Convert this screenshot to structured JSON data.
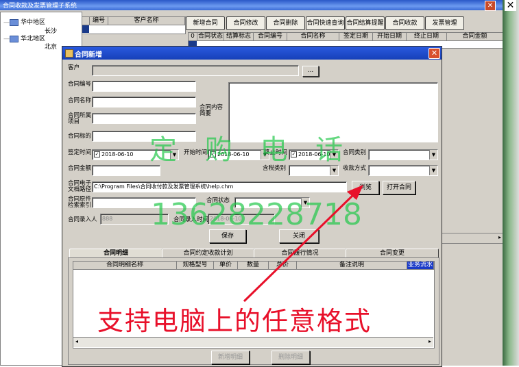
{
  "main": {
    "title": "合同收款及发票管理子系统",
    "close": "✕",
    "right_close": "✕",
    "tree": [
      {
        "label": "华中地区",
        "child": "长沙"
      },
      {
        "label": "华北地区",
        "child": "北京"
      }
    ],
    "grid1_headers": [
      "编号",
      "客户名称"
    ],
    "toolbar": [
      "新增合同",
      "合同修改",
      "合同删除",
      "合同快速查询",
      "合同结算提醒",
      "合同收款",
      "发票管理"
    ],
    "grid2_headers": [
      "0",
      "合同状态",
      "结算标志",
      "合同编号",
      "合同名称",
      "签定日期",
      "开始日期",
      "终止日期",
      "合同金额"
    ]
  },
  "dialog": {
    "title": "合同新增",
    "close": "✕",
    "customer_label": "客户",
    "customer_browse": "...",
    "contract_no_label": "合同编号",
    "contract_name_label": "合同名称",
    "contract_project_label": "合同所属项目",
    "contract_target_label": "合同标的",
    "contract_content_label": "合同内容简要",
    "sign_time_label": "签定时间",
    "sign_time_value": "2018-06-10",
    "start_time_label": "开始时间",
    "start_time_value": "2018-06-10",
    "end_time_label": "终止时间",
    "end_time_value": "2018-06-10",
    "contract_type_label": "合同类别",
    "amount_label": "合同金额",
    "tax_type_label": "含税类别",
    "payment_method_label": "收款方式",
    "doc_path_label": "合同电子文档路径",
    "doc_path_value": "C:\\Program Files\\合同收付款及发票管理系统\\help.chm",
    "browse_button": "浏览",
    "open_button": "打开合同",
    "original_index_label": "合同原件检索索引",
    "status_label": "合同状态",
    "entry_person_label": "合同录入人",
    "entry_person_value": "888",
    "entry_time_label": "合同录入时间",
    "entry_time_value": "2018-06-10",
    "save_button": "保存",
    "close_button": "关闭",
    "tabs": [
      "合同明细",
      "合同约定收款计划",
      "合同履行情况",
      "合同变更"
    ],
    "detail_headers": [
      "合同明细名称",
      "规格型号",
      "单价",
      "数量",
      "总价",
      "备注说明",
      "业务流水"
    ],
    "add_detail_button": "新增明细",
    "delete_detail_button": "删除明细"
  },
  "overlay": {
    "watermark_line1": "定 购 电 话",
    "watermark_line2": "13628228718",
    "annotation": "支持电脑上的任意格式"
  },
  "colors": {
    "titlebar": "#2a5ae0",
    "watermark": "#22c84a",
    "annotation": "#e8102a"
  }
}
